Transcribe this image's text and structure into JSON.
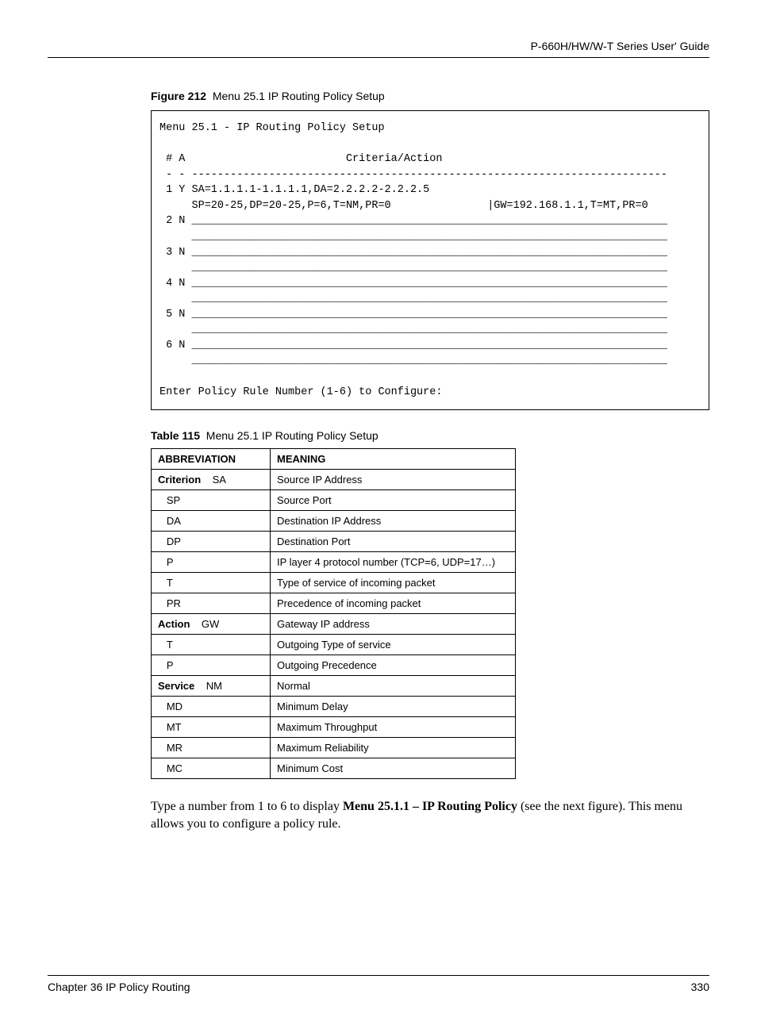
{
  "header": {
    "guide_title": "P-660H/HW/W-T Series User' Guide"
  },
  "figure": {
    "label": "Figure 212",
    "caption": "Menu 25.1 IP Routing Policy Setup"
  },
  "codebox": {
    "title_line": "Menu 25.1 - IP Routing Policy Setup",
    "header_row": " # A                         Criteria/Action",
    "sep_row": " - - --------------------------------------------------------------------------",
    "row1a": " 1 Y SA=1.1.1.1-1.1.1.1,DA=2.2.2.2-2.2.2.5",
    "row1b_left": "     SP=20-25,DP=20-25,P=6,T=NM,PR=0",
    "row1b_right": "|GW=192.168.1.1,T=MT,PR=0",
    "row2": " 2 N __________________________________________________________________________",
    "blank_underline": "     __________________________________________________________________________",
    "row3": " 3 N __________________________________________________________________________",
    "row4": " 4 N __________________________________________________________________________",
    "row5": " 5 N __________________________________________________________________________",
    "row6": " 6 N __________________________________________________________________________",
    "prompt": "Enter Policy Rule Number (1-6) to Configure:"
  },
  "table": {
    "label": "Table 115",
    "caption": "Menu 25.1 IP Routing Policy Setup",
    "head_abbr": "ABBREVIATION",
    "head_mean": "MEANING",
    "rows": [
      {
        "group": "Criterion",
        "code": "SA",
        "meaning": "Source IP Address"
      },
      {
        "group": "",
        "code": "SP",
        "meaning": "Source Port"
      },
      {
        "group": "",
        "code": "DA",
        "meaning": "Destination IP Address"
      },
      {
        "group": "",
        "code": "DP",
        "meaning": "Destination Port"
      },
      {
        "group": "",
        "code": "P",
        "meaning": "IP layer 4 protocol number (TCP=6, UDP=17…)"
      },
      {
        "group": "",
        "code": "T",
        "meaning": "Type of service of incoming packet"
      },
      {
        "group": "",
        "code": "PR",
        "meaning": "Precedence of incoming packet"
      },
      {
        "group": "Action",
        "code": "GW",
        "meaning": "Gateway IP address"
      },
      {
        "group": "",
        "code": "T",
        "meaning": "Outgoing Type of service"
      },
      {
        "group": "",
        "code": "P",
        "meaning": "Outgoing Precedence"
      },
      {
        "group": "Service",
        "code": "NM",
        "meaning": "Normal"
      },
      {
        "group": "",
        "code": "MD",
        "meaning": "Minimum Delay"
      },
      {
        "group": "",
        "code": "MT",
        "meaning": "Maximum Throughput"
      },
      {
        "group": "",
        "code": "MR",
        "meaning": "Maximum Reliability"
      },
      {
        "group": "",
        "code": "MC",
        "meaning": "Minimum Cost"
      }
    ]
  },
  "body": {
    "pre": "Type a number from 1 to 6 to display ",
    "bold": "Menu 25.1.1 – IP Routing Policy",
    "post": " (see the next figure). This menu allows you to configure a policy rule."
  },
  "footer": {
    "chapter": "Chapter 36 IP Policy Routing",
    "page": "330"
  }
}
